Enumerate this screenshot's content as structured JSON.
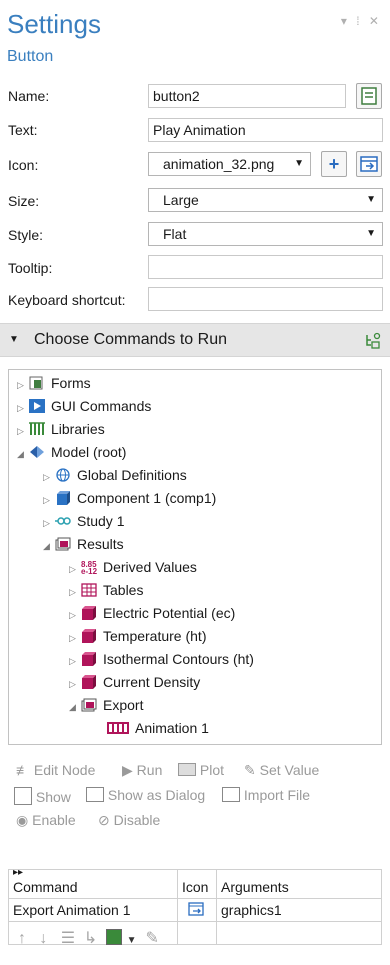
{
  "header": {
    "title": "Settings",
    "subtitle": "Button",
    "window_controls": "▾ ⁞ ✕"
  },
  "form": {
    "name_label": "Name:",
    "name_value": "button2",
    "text_label": "Text:",
    "text_value": "Play Animation",
    "icon_label": "Icon:",
    "icon_value": "animation_32.png",
    "size_label": "Size:",
    "size_value": "Large",
    "style_label": "Style:",
    "style_value": "Flat",
    "tooltip_label": "Tooltip:",
    "tooltip_value": "",
    "shortcut_label": "Keyboard shortcut:",
    "shortcut_value": ""
  },
  "section": {
    "title": "Choose Commands to Run"
  },
  "tree": {
    "forms": "Forms",
    "gui_commands": "GUI Commands",
    "libraries": "Libraries",
    "model": "Model (root)",
    "global_definitions": "Global Definitions",
    "component": "Component 1 (comp1)",
    "study": "Study 1",
    "results": "Results",
    "derived_values": "Derived Values",
    "tables": "Tables",
    "electric_potential": "Electric Potential (ec)",
    "temperature": "Temperature (ht)",
    "isothermal": "Isothermal Contours (ht)",
    "current_density": "Current Density",
    "export": "Export",
    "animation": "Animation 1"
  },
  "toolbar": {
    "edit_node": "Edit Node",
    "run": "Run",
    "plot": "Plot",
    "set_value": "Set Value",
    "show": "Show",
    "show_dialog": "Show as Dialog",
    "import_file": "Import File",
    "enable": "Enable",
    "disable": "Disable"
  },
  "commands_table": {
    "headers": [
      "Command",
      "Icon",
      "Arguments"
    ],
    "rows": [
      {
        "command": "Export Animation 1",
        "arguments": "graphics1"
      }
    ]
  },
  "colors": {
    "accent": "#3a7fbf",
    "results_icon": "#b0145a"
  }
}
